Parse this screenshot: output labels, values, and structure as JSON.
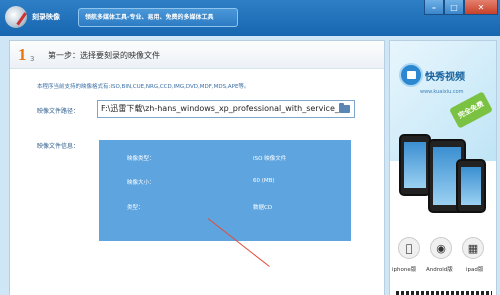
{
  "titlebar": {
    "app_title": "刻录映像",
    "slogan": "领航多媒体工具-专业、易用、免费的多媒体工具"
  },
  "window_controls": {
    "minimize": "–",
    "maximize": "□",
    "close": "✕"
  },
  "step": {
    "number": "1",
    "total": "3",
    "title": "第一步：选择要刻录的映像文件"
  },
  "supported_formats": "本程序当前支持的映像格式有:ISO,BIN,CUE,NRG,CCD,IMG,DVD,MDF,MDS,APE等。",
  "image_path": {
    "label": "映像文件路径：",
    "value": "F:\\迅雷下载\\zh-hans_windows_xp_professional_with_service_"
  },
  "image_info": {
    "label": "映像文件信息：",
    "rows": [
      {
        "key": "映像类型：",
        "value": "ISO 映像文件"
      },
      {
        "key": "映像大小：",
        "value": "60 (MB)"
      },
      {
        "key": "类型：",
        "value": "数据CD"
      }
    ]
  },
  "ad": {
    "brand": "快秀视频",
    "tagline": "www.kuaixiu.com",
    "badge": "完全免费",
    "platforms": [
      {
        "icon": "apple-icon",
        "label": "iphone版"
      },
      {
        "icon": "android-icon",
        "label": "Android版"
      },
      {
        "icon": "ipad-icon",
        "label": "ipad版"
      }
    ]
  },
  "colors": {
    "titlebar": "#1e6fb8",
    "info_box": "#5ea5e0",
    "step_number": "#e8750f",
    "arrow": "#e24b3b"
  }
}
